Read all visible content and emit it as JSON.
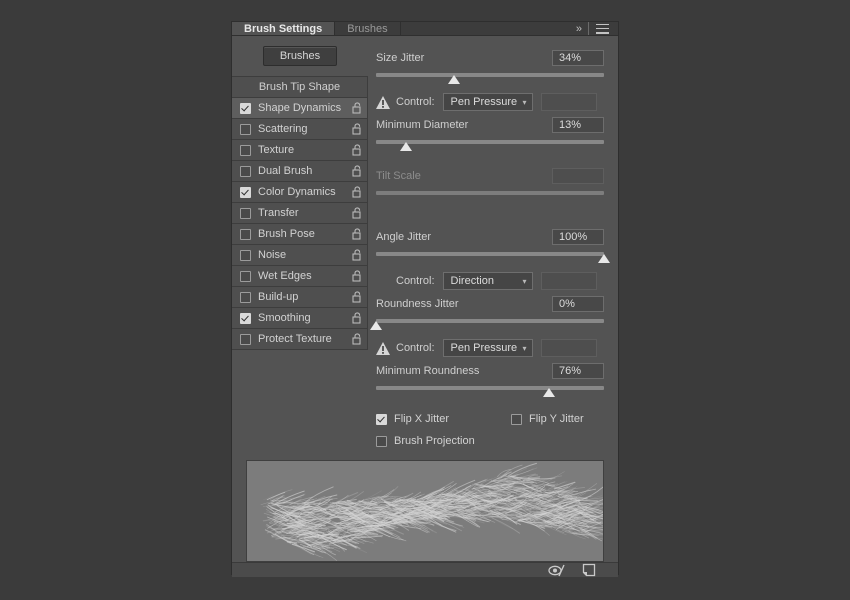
{
  "window": {
    "title": "Brush Settings"
  },
  "tabs": [
    {
      "label": "Brush Settings",
      "active": true
    },
    {
      "label": "Brushes",
      "active": false
    }
  ],
  "tabtools": {
    "collapse_icon": "double-chevron-right-icon",
    "collapse_glyph": "»",
    "menu_icon": "panel-menu-icon"
  },
  "sidebar": {
    "brushes_button": "Brushes",
    "header": "Brush Tip Shape",
    "items": [
      {
        "label": "Shape Dynamics",
        "checked": true,
        "selected": true,
        "locked": false
      },
      {
        "label": "Scattering",
        "checked": false,
        "selected": false,
        "locked": false
      },
      {
        "label": "Texture",
        "checked": false,
        "selected": false,
        "locked": false
      },
      {
        "label": "Dual Brush",
        "checked": false,
        "selected": false,
        "locked": false
      },
      {
        "label": "Color Dynamics",
        "checked": true,
        "selected": false,
        "locked": false
      },
      {
        "label": "Transfer",
        "checked": false,
        "selected": false,
        "locked": false
      },
      {
        "label": "Brush Pose",
        "checked": false,
        "selected": false,
        "locked": false
      },
      {
        "label": "Noise",
        "checked": false,
        "selected": false,
        "locked": false
      },
      {
        "label": "Wet Edges",
        "checked": false,
        "selected": false,
        "locked": false
      },
      {
        "label": "Build-up",
        "checked": false,
        "selected": false,
        "locked": false
      },
      {
        "label": "Smoothing",
        "checked": true,
        "selected": false,
        "locked": false
      },
      {
        "label": "Protect Texture",
        "checked": false,
        "selected": false,
        "locked": false
      }
    ]
  },
  "settings": {
    "size_jitter": {
      "label": "Size Jitter",
      "value": "34%",
      "percent": 34,
      "enabled": true
    },
    "size_control": {
      "label": "Control:",
      "value": "Pen Pressure",
      "warning": true
    },
    "minimum_diameter": {
      "label": "Minimum Diameter",
      "value": "13%",
      "percent": 13,
      "enabled": true
    },
    "tilt_scale": {
      "label": "Tilt Scale",
      "value": "",
      "percent": 0,
      "enabled": false
    },
    "angle_jitter": {
      "label": "Angle Jitter",
      "value": "100%",
      "percent": 100,
      "enabled": true
    },
    "angle_control": {
      "label": "Control:",
      "value": "Direction",
      "warning": false
    },
    "roundness_jitter": {
      "label": "Roundness Jitter",
      "value": "0%",
      "percent": 0,
      "enabled": true
    },
    "roundness_control": {
      "label": "Control:",
      "value": "Pen Pressure",
      "warning": true
    },
    "minimum_roundness": {
      "label": "Minimum Roundness",
      "value": "76%",
      "percent": 76,
      "enabled": true
    },
    "flip_x_jitter": {
      "label": "Flip X Jitter",
      "checked": true
    },
    "flip_y_jitter": {
      "label": "Flip Y Jitter",
      "checked": false
    },
    "brush_projection": {
      "label": "Brush Projection",
      "checked": false
    }
  },
  "preview": {
    "name": "brush-stroke-preview",
    "stroke_color": "#f2f2f2",
    "background_color": "#7c7c7c"
  },
  "footer": {
    "toggle_preview_icon": "eye-slash-icon",
    "new_brush_icon": "new-brush-page-icon"
  },
  "colors": {
    "panel_bg": "#535353",
    "tab_bg": "#3c3c3c",
    "list_bg": "#4f4f4f",
    "selection": "#5e5e5e",
    "text": "#d2d2d2",
    "slider_track": "#888888",
    "thumb": "#e8e8e8"
  }
}
